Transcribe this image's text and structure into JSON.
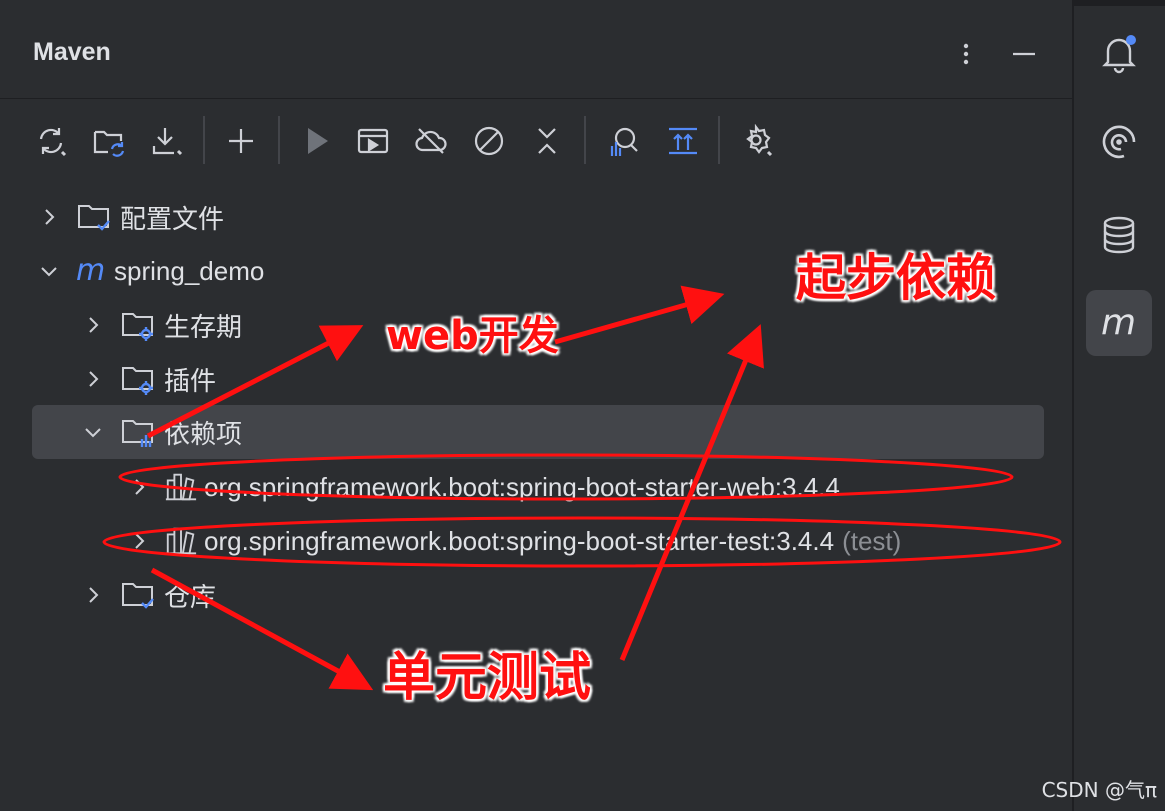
{
  "panel": {
    "title": "Maven",
    "more_icon": "more-vertical-icon",
    "minimize_icon": "minimize-icon"
  },
  "toolbar": {
    "buttons": [
      {
        "name": "reload-all-projects",
        "icon": "sync-icon"
      },
      {
        "name": "generate-sources",
        "icon": "folder-refresh-icon"
      },
      {
        "name": "download-sources",
        "icon": "download-icon"
      },
      {
        "name": "add-maven-project",
        "icon": "plus-icon"
      },
      {
        "name": "run-maven-build",
        "icon": "play-icon"
      },
      {
        "name": "execute-maven-goal",
        "icon": "run-window-icon"
      },
      {
        "name": "toggle-offline-mode",
        "icon": "cloud-off-icon"
      },
      {
        "name": "skip-tests",
        "icon": "skip-icon"
      },
      {
        "name": "collapse-all",
        "icon": "collapse-icon"
      },
      {
        "name": "analyze-dependencies",
        "icon": "analyze-icon"
      },
      {
        "name": "show-diagram",
        "icon": "diagram-icon"
      },
      {
        "name": "build-tool-settings",
        "icon": "gear-icon"
      }
    ]
  },
  "tree": {
    "profiles": "配置文件",
    "project": "spring_demo",
    "lifecycle": "生存期",
    "plugins": "插件",
    "dependencies": "依赖项",
    "dep_web": "org.springframework.boot:spring-boot-starter-web:3.4.4",
    "dep_test": "org.springframework.boot:spring-boot-starter-test:3.4.4",
    "dep_test_scope": "(test)",
    "repositories": "仓库"
  },
  "annotations": {
    "web": "web开发",
    "starter": "起步依赖",
    "unit_test": "单元测试"
  },
  "sidebar": {
    "items": [
      "notifications-icon",
      "ai-assistant-icon",
      "database-icon",
      "maven-icon"
    ]
  },
  "watermark": "CSDN @气π",
  "colors": {
    "background": "#2b2d30",
    "selected_row": "#43454a",
    "accent_blue": "#548af7",
    "annotation_red": "#ff1010"
  }
}
